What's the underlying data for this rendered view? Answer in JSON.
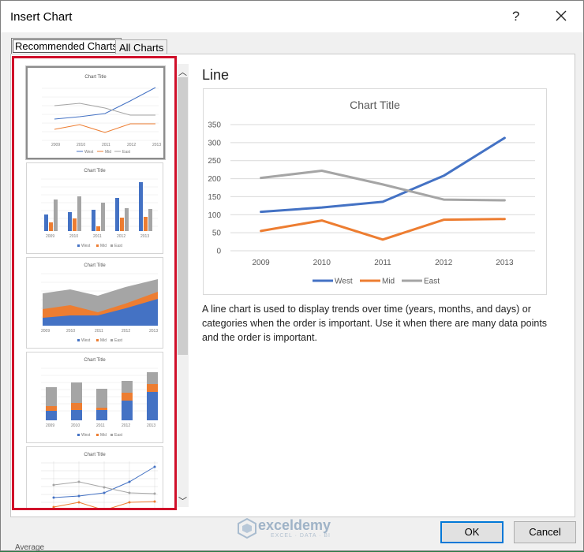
{
  "dialog": {
    "title": "Insert Chart",
    "help_label": "?",
    "tabs": [
      {
        "label": "Recommended Charts",
        "selected": true
      },
      {
        "label": "All Charts",
        "selected": false
      }
    ],
    "ok_label": "OK",
    "cancel_label": "Cancel"
  },
  "thumbnails": [
    {
      "kind": "line",
      "title": "Chart Title",
      "selected": true
    },
    {
      "kind": "clustered-column",
      "title": "Chart Title",
      "selected": false
    },
    {
      "kind": "stacked-area",
      "title": "Chart Title",
      "selected": false
    },
    {
      "kind": "stacked-column",
      "title": "Chart Title",
      "selected": false
    },
    {
      "kind": "line-with-markers",
      "title": "Chart Title",
      "selected": false
    }
  ],
  "preview": {
    "heading": "Line",
    "description": "A line chart is used to display trends over time (years, months, and days) or categories when the order is important. Use it when there are many data points and the order is important."
  },
  "chart_data": {
    "type": "line",
    "title": "Chart Title",
    "categories": [
      "2009",
      "2010",
      "2011",
      "2012",
      "2013"
    ],
    "yticks": [
      "0",
      "50",
      "100",
      "150",
      "200",
      "250",
      "300",
      "350"
    ],
    "ylim": [
      0,
      350
    ],
    "grid": true,
    "legend_position": "bottom",
    "series": [
      {
        "name": "West",
        "color": "#4472c4",
        "values": [
          108,
          120,
          136,
          208,
          313
        ]
      },
      {
        "name": "Mid",
        "color": "#ed7d31",
        "values": [
          55,
          84,
          31,
          86,
          88
        ]
      },
      {
        "name": "East",
        "color": "#a5a5a5",
        "values": [
          202,
          222,
          184,
          142,
          140
        ]
      }
    ]
  },
  "watermark": {
    "name": "exceldemy",
    "tagline": "EXCEL · DATA · BI"
  },
  "background_peek": "Average"
}
